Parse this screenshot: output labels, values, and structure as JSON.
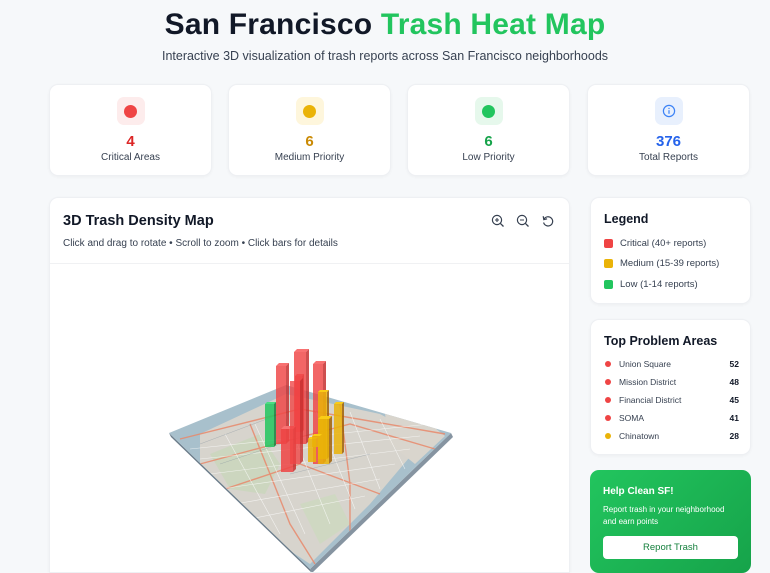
{
  "header": {
    "title_main": "San Francisco ",
    "title_accent": "Trash Heat Map",
    "subtitle": "Interactive 3D visualization of trash reports across San Francisco neighborhoods"
  },
  "stats": [
    {
      "value": "4",
      "label": "Critical Areas",
      "color": "#ef4444",
      "bg": "#fdecec",
      "icon": "red-dot-icon"
    },
    {
      "value": "6",
      "label": "Medium Priority",
      "color": "#eab308",
      "bg": "#fef6dc",
      "icon": "yellow-dot-icon"
    },
    {
      "value": "6",
      "label": "Low Priority",
      "color": "#22c55e",
      "bg": "#e6f8ec",
      "icon": "green-dot-icon"
    },
    {
      "value": "376",
      "label": "Total Reports",
      "color": "#2563eb",
      "bg": "#e8f0fd",
      "icon": "info-icon"
    }
  ],
  "map": {
    "title": "3D Trash Density Map",
    "hint": "Click and drag to rotate • Scroll to zoom • Click bars for details",
    "tools": [
      "zoom-in-icon",
      "zoom-out-icon",
      "reset-icon"
    ]
  },
  "legend": {
    "title": "Legend",
    "items": [
      {
        "label": "Critical (40+ reports)",
        "color": "#ef4444"
      },
      {
        "label": "Medium (15-39 reports)",
        "color": "#eab308"
      },
      {
        "label": "Low (1-14 reports)",
        "color": "#22c55e"
      }
    ]
  },
  "top_areas": {
    "title": "Top Problem Areas",
    "items": [
      {
        "name": "Union Square",
        "count": "52",
        "color": "#ef4444"
      },
      {
        "name": "Mission District",
        "count": "48",
        "color": "#ef4444"
      },
      {
        "name": "Financial District",
        "count": "45",
        "color": "#ef4444"
      },
      {
        "name": "SOMA",
        "count": "41",
        "color": "#ef4444"
      },
      {
        "name": "Chinatown",
        "count": "28",
        "color": "#eab308"
      }
    ]
  },
  "help": {
    "title": "Help Clean SF!",
    "text": "Report trash in your neighborhood and earn points",
    "button": "Report Trash"
  }
}
